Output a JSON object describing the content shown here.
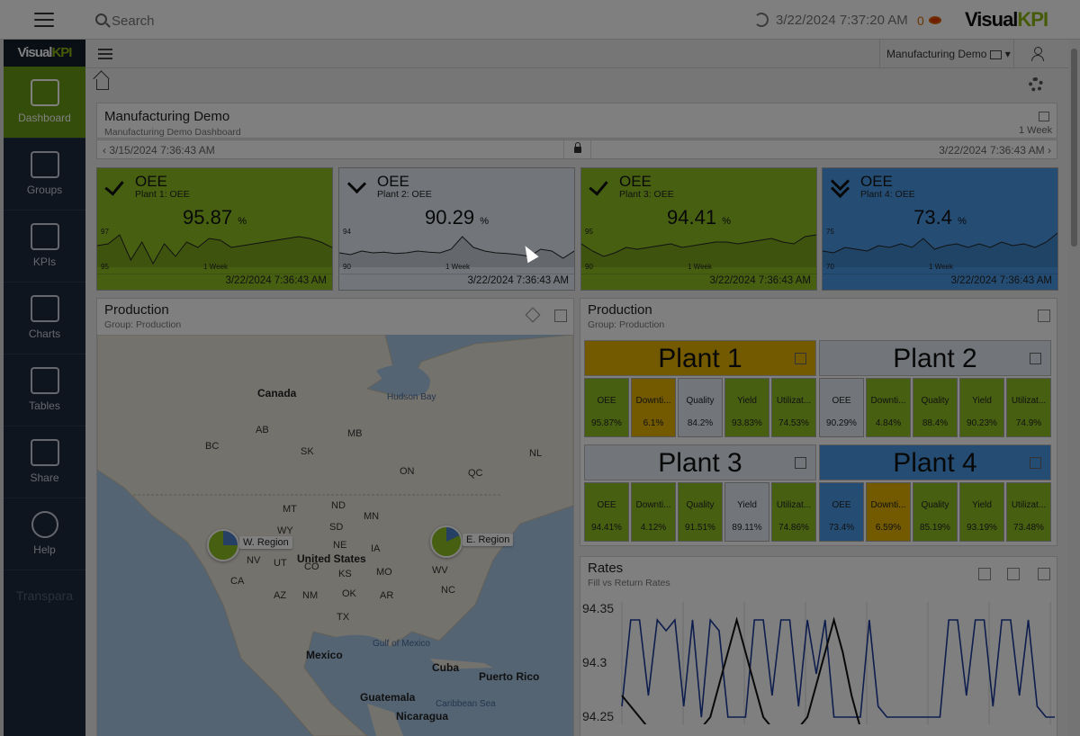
{
  "topbar": {
    "search_placeholder": "Search",
    "timestamp": "3/22/2024 7:37:20 AM",
    "alert_count": "0",
    "logo_main": "Visual",
    "logo_accent": "KPI"
  },
  "sidebar": {
    "logo_main": "Visual",
    "logo_accent": "KPI",
    "items": [
      {
        "label": "Dashboard",
        "icon": "dashboard-icon"
      },
      {
        "label": "Groups",
        "icon": "folder-icon"
      },
      {
        "label": "KPIs",
        "icon": "kpi-bars-icon"
      },
      {
        "label": "Charts",
        "icon": "chart-icon"
      },
      {
        "label": "Tables",
        "icon": "table-icon"
      },
      {
        "label": "Share",
        "icon": "share-icon"
      },
      {
        "label": "Help",
        "icon": "help-icon"
      }
    ],
    "footer": "Transpara"
  },
  "subheader": {
    "context": "Manufacturing Demo"
  },
  "dashboard": {
    "title": "Manufacturing Demo",
    "subtitle": "Manufacturing Demo Dashboard",
    "period": "1 Week",
    "range_start": "3/15/2024 7:36:43 AM",
    "range_end": "3/22/2024 7:36:43 AM"
  },
  "kpis": [
    {
      "name": "OEE",
      "sub": "Plant 1: OEE",
      "value": "95.87",
      "unit": "%",
      "ymax": "97",
      "ymin": "95",
      "xlabel": "1 Week",
      "time": "3/22/2024 7:36:43 AM",
      "status": "check",
      "color": "#8fbf22",
      "spark": [
        0.4,
        0.35,
        0.1,
        0.8,
        0.3,
        0.9,
        0.35,
        0.7,
        0.3,
        0.45,
        0.2,
        0.25,
        0.45,
        0.4,
        0.35,
        0.3,
        0.25,
        0.2,
        0.15,
        0.2,
        0.3,
        0.45
      ]
    },
    {
      "name": "OEE",
      "sub": "Plant 2: OEE",
      "value": "90.29",
      "unit": "%",
      "ymax": "94",
      "ymin": "90",
      "xlabel": "1 Week",
      "time": "3/22/2024 7:36:43 AM",
      "status": "down",
      "color": "#e4ecf6",
      "spark": [
        0.6,
        0.65,
        0.55,
        0.6,
        0.58,
        0.62,
        0.6,
        0.55,
        0.58,
        0.6,
        0.5,
        0.15,
        0.45,
        0.55,
        0.6,
        0.62,
        0.65,
        0.7,
        0.5,
        0.55,
        0.75,
        0.55
      ]
    },
    {
      "name": "OEE",
      "sub": "Plant 3: OEE",
      "value": "94.41",
      "unit": "%",
      "ymax": "95",
      "ymin": "90",
      "xlabel": "1 Week",
      "time": "3/22/2024 7:36:43 AM",
      "status": "check",
      "color": "#8fbf22",
      "spark": [
        0.35,
        0.55,
        0.7,
        0.6,
        0.45,
        0.5,
        0.45,
        0.4,
        0.35,
        0.45,
        0.4,
        0.35,
        0.3,
        0.3,
        0.35,
        0.3,
        0.25,
        0.2,
        0.3,
        0.35,
        0.15,
        0.1
      ]
    },
    {
      "name": "OEE",
      "sub": "Plant 4: OEE",
      "value": "73.4",
      "unit": "%",
      "ymax": "75",
      "ymin": "70",
      "xlabel": "1 Week",
      "time": "3/22/2024 7:36:43 AM",
      "status": "ddown",
      "color": "#4a9be8",
      "spark": [
        0.55,
        0.6,
        0.45,
        0.5,
        0.55,
        0.4,
        0.45,
        0.35,
        0.45,
        0.2,
        0.5,
        0.4,
        0.35,
        0.45,
        0.35,
        0.45,
        0.3,
        0.4,
        0.35,
        0.45,
        0.3,
        0.05
      ]
    }
  ],
  "map_widget": {
    "title": "Production",
    "subtitle": "Group: Production",
    "labels": [
      {
        "text": "Canada",
        "kind": "big"
      },
      {
        "text": "Hudson Bay",
        "kind": "water"
      },
      {
        "text": "United States",
        "kind": "big"
      },
      {
        "text": "Mexico",
        "kind": "big"
      },
      {
        "text": "Gulf of Mexico",
        "kind": "water"
      },
      {
        "text": "Cuba",
        "kind": "big"
      },
      {
        "text": "Puerto Rico",
        "kind": "big"
      },
      {
        "text": "Guatemala",
        "kind": "big"
      },
      {
        "text": "Nicaragua",
        "kind": "big"
      },
      {
        "text": "Caribbean Sea",
        "kind": "water"
      },
      {
        "text": "BC",
        "kind": "small"
      },
      {
        "text": "AB",
        "kind": "small"
      },
      {
        "text": "SK",
        "kind": "small"
      },
      {
        "text": "MB",
        "kind": "small"
      },
      {
        "text": "ON",
        "kind": "small"
      },
      {
        "text": "QC",
        "kind": "small"
      },
      {
        "text": "NL",
        "kind": "small"
      },
      {
        "text": "MT",
        "kind": "small"
      },
      {
        "text": "ND",
        "kind": "small"
      },
      {
        "text": "SD",
        "kind": "small"
      },
      {
        "text": "WY",
        "kind": "small"
      },
      {
        "text": "NE",
        "kind": "small"
      },
      {
        "text": "MN",
        "kind": "small"
      },
      {
        "text": "IA",
        "kind": "small"
      },
      {
        "text": "NV",
        "kind": "small"
      },
      {
        "text": "UT",
        "kind": "small"
      },
      {
        "text": "CO",
        "kind": "small"
      },
      {
        "text": "KS",
        "kind": "small"
      },
      {
        "text": "AZ",
        "kind": "small"
      },
      {
        "text": "NM",
        "kind": "small"
      },
      {
        "text": "OK",
        "kind": "small"
      },
      {
        "text": "TX",
        "kind": "small"
      },
      {
        "text": "AR",
        "kind": "small"
      },
      {
        "text": "MO",
        "kind": "small"
      },
      {
        "text": "CA",
        "kind": "small"
      },
      {
        "text": "WV",
        "kind": "small"
      },
      {
        "text": "NC",
        "kind": "small"
      }
    ],
    "regions": [
      {
        "name": "W. Region"
      },
      {
        "name": "E. Region"
      }
    ]
  },
  "plants_widget": {
    "title": "Production",
    "subtitle": "Group: Production",
    "plants": [
      {
        "name": "Plant 1",
        "head_color": "#e6b400",
        "cells": [
          {
            "name": "OEE",
            "value": "95.87%",
            "color": "#8fbf22"
          },
          {
            "name": "Downti...",
            "value": "6.1%",
            "color": "#e6b400"
          },
          {
            "name": "Quality",
            "value": "84.2%",
            "color": "#e4ecf6"
          },
          {
            "name": "Yield",
            "value": "93.83%",
            "color": "#8fbf22"
          },
          {
            "name": "Utilizat...",
            "value": "74.53%",
            "color": "#8fbf22"
          }
        ]
      },
      {
        "name": "Plant 2",
        "head_color": "#e4ecf6",
        "cells": [
          {
            "name": "OEE",
            "value": "90.29%",
            "color": "#e4ecf6"
          },
          {
            "name": "Downti...",
            "value": "4.84%",
            "color": "#8fbf22"
          },
          {
            "name": "Quality",
            "value": "88.4%",
            "color": "#8fbf22"
          },
          {
            "name": "Yield",
            "value": "90.23%",
            "color": "#8fbf22"
          },
          {
            "name": "Utilizat...",
            "value": "74.9%",
            "color": "#8fbf22"
          }
        ]
      },
      {
        "name": "Plant 3",
        "head_color": "#e4ecf6",
        "cells": [
          {
            "name": "OEE",
            "value": "94.41%",
            "color": "#8fbf22"
          },
          {
            "name": "Downti...",
            "value": "4.12%",
            "color": "#8fbf22"
          },
          {
            "name": "Quality",
            "value": "91.51%",
            "color": "#8fbf22"
          },
          {
            "name": "Yield",
            "value": "89.11%",
            "color": "#e4ecf6"
          },
          {
            "name": "Utilizat...",
            "value": "74.86%",
            "color": "#8fbf22"
          }
        ]
      },
      {
        "name": "Plant 4",
        "head_color": "#4a9be8",
        "cells": [
          {
            "name": "OEE",
            "value": "73.4%",
            "color": "#4a9be8"
          },
          {
            "name": "Downti...",
            "value": "6.59%",
            "color": "#e6b400"
          },
          {
            "name": "Quality",
            "value": "85.19%",
            "color": "#8fbf22"
          },
          {
            "name": "Yield",
            "value": "93.19%",
            "color": "#8fbf22"
          },
          {
            "name": "Utilizat...",
            "value": "73.48%",
            "color": "#8fbf22"
          }
        ]
      }
    ]
  },
  "rates_widget": {
    "title": "Rates",
    "subtitle": "Fill vs Return Rates"
  },
  "chart_data": {
    "type": "line",
    "title": "Rates",
    "subtitle": "Fill vs Return Rates",
    "ylim": [
      94.25,
      94.35
    ],
    "yticks": [
      "94.35",
      "94.3",
      "94.25"
    ],
    "grid": true,
    "series": [
      {
        "color": "#1a3a9a",
        "values": [
          94.26,
          94.34,
          94.34,
          94.27,
          94.34,
          94.33,
          94.34,
          94.26,
          94.34,
          94.25,
          94.34,
          94.33,
          94.25,
          94.25,
          94.25,
          94.34,
          94.34,
          94.27,
          94.34,
          94.34,
          94.26,
          94.34,
          94.29,
          94.34,
          94.25,
          94.25,
          94.25,
          94.25,
          94.34,
          94.26,
          94.25,
          94.25,
          94.25,
          94.25,
          94.25,
          94.25,
          94.25,
          94.34,
          94.34,
          94.27,
          94.34,
          94.34,
          94.26,
          94.34,
          94.34,
          94.27,
          94.34,
          94.26,
          94.25,
          94.25
        ]
      },
      {
        "color": "#111111",
        "values": [
          94.27,
          94.26,
          94.25,
          94.24,
          94.24,
          94.24,
          94.24,
          94.24,
          94.24,
          94.24,
          94.25,
          94.28,
          94.31,
          94.34,
          94.31,
          94.28,
          94.25,
          94.24,
          94.24,
          94.24,
          94.24,
          94.25,
          94.28,
          94.31,
          94.34,
          94.31,
          94.27,
          94.24,
          94.24,
          94.24,
          94.24,
          94.24,
          94.24,
          94.24,
          94.24,
          94.24,
          94.24,
          94.24,
          94.24,
          94.24,
          94.24,
          94.24,
          94.24,
          94.24,
          94.24,
          94.24,
          94.24,
          94.24,
          94.24,
          94.24
        ]
      }
    ]
  }
}
